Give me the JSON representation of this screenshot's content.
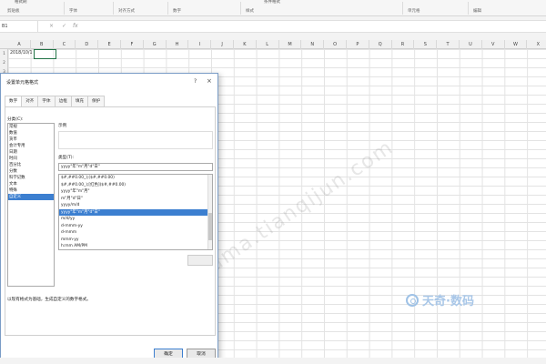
{
  "ribbon": {
    "top_left_text": "格式刷",
    "top_mid_text": "条件格式",
    "groups": [
      "剪贴板",
      "字体",
      "对齐方式",
      "数字",
      "样式",
      "单元格",
      "编辑"
    ]
  },
  "formula_bar": {
    "name_box": "B1",
    "cancel_glyph": "×",
    "enter_glyph": "✓",
    "fx_label": "fx"
  },
  "sheet": {
    "columns": [
      "A",
      "B",
      "C",
      "D",
      "E",
      "F",
      "G",
      "H",
      "I",
      "J",
      "K",
      "L",
      "M",
      "N",
      "O",
      "P",
      "Q",
      "R",
      "S",
      "T",
      "U",
      "V",
      "W",
      "X"
    ],
    "rows": [
      "1",
      "2",
      "3",
      "4",
      "5",
      "6",
      "7",
      "8",
      "9",
      "10",
      "11",
      "12",
      "13",
      "14",
      "15",
      "16",
      "17",
      "18",
      "19",
      "20",
      "21",
      "22",
      "23",
      "24",
      "25",
      "26",
      "27",
      "28",
      "29",
      "30",
      "31",
      "32",
      "33",
      "34"
    ],
    "a1_value": "2018/10/1"
  },
  "dialog": {
    "title": "设置单元格格式",
    "help_glyph": "?",
    "close_glyph": "×",
    "tabs": [
      "数字",
      "对齐",
      "字体",
      "边框",
      "填充",
      "保护"
    ],
    "category_label": "分类(C):",
    "categories": [
      "常规",
      "数值",
      "货币",
      "会计专用",
      "日期",
      "时间",
      "百分比",
      "分数",
      "科学记数",
      "文本",
      "特殊",
      "自定义"
    ],
    "selected_category": "自定义",
    "sample_label": "示例",
    "type_label": "类型(T):",
    "type_value": "yyyy\"年\"m\"月\"d\"日\"",
    "formats": [
      "$#,##0.00_);($#,##0.00)",
      "$#,##0.00_);[红色]($#,##0.00)",
      "yyyy\"年\"m\"月\"",
      "m\"月\"d\"日\"",
      "yyyy/m/d",
      "yyyy\"年\"m\"月\"d\"日\"",
      "m/d/yy",
      "d-mmm-yy",
      "d-mmm",
      "mmm-yy",
      "h:mm AM/PM"
    ],
    "selected_format": "yyyy\"年\"m\"月\"d\"日\"",
    "description": "以现有格式为基础，生成自定义的数字格式。",
    "ok_label": "确定",
    "cancel_label": "取消"
  },
  "watermark": "shuma.tianqijun.com",
  "logo_text": "天奇·数码",
  "colors": {
    "selection": "#3c7fd0",
    "active_cell_border": "#217346",
    "dialog_border": "#7a9cc6"
  }
}
